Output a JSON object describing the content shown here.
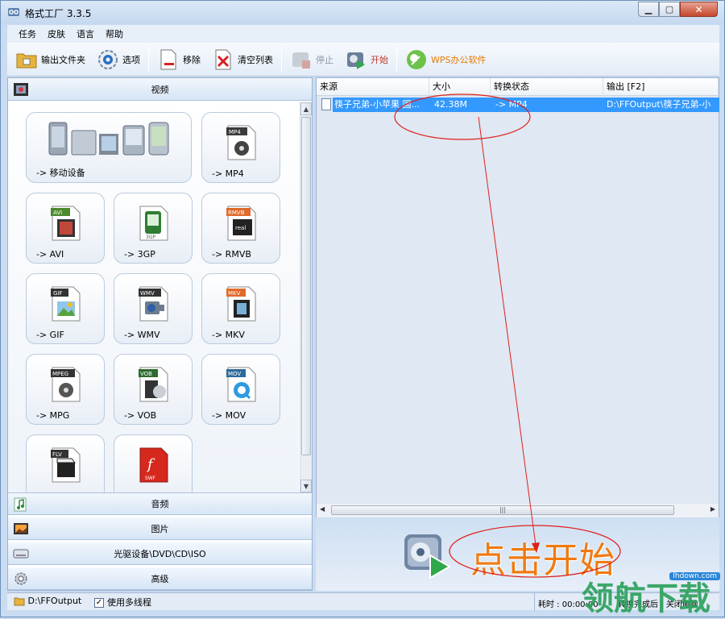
{
  "window": {
    "title": "格式工厂 3.3.5"
  },
  "menu": [
    "任务",
    "皮肤",
    "语言",
    "帮助"
  ],
  "toolbar": {
    "output_folder": "输出文件夹",
    "options": "选项",
    "remove": "移除",
    "clear_list": "清空列表",
    "stop": "停止",
    "start": "开始",
    "wps": "WPS办公软件"
  },
  "categories": {
    "video": "视频",
    "audio": "音频",
    "image": "图片",
    "disc": "光驱设备\\DVD\\CD\\ISO",
    "advanced": "高级"
  },
  "tiles": [
    {
      "label": "-> 移动设备",
      "badge": ""
    },
    {
      "label": "-> MP4",
      "badge": "MP4"
    },
    {
      "label": "-> AVI",
      "badge": "AVI"
    },
    {
      "label": "-> 3GP",
      "badge": "3GP"
    },
    {
      "label": "-> RMVB",
      "badge": "RMVB"
    },
    {
      "label": "-> GIF",
      "badge": "GIF"
    },
    {
      "label": "-> WMV",
      "badge": "WMV"
    },
    {
      "label": "-> MKV",
      "badge": "MKV"
    },
    {
      "label": "-> MPG",
      "badge": "MPEG"
    },
    {
      "label": "-> VOB",
      "badge": "VOB"
    },
    {
      "label": "-> MOV",
      "badge": "MOV"
    },
    {
      "label": "",
      "badge": "FLV"
    },
    {
      "label": "",
      "badge": "SWF"
    }
  ],
  "list": {
    "headers": [
      "来源",
      "大小",
      "转换状态",
      "输出 [F2]"
    ],
    "rows": [
      {
        "source": "筷子兄弟-小苹果 国...",
        "size": "42.38M",
        "status": "-> MP4",
        "output": "D:\\FFOutput\\筷子兄弟-小"
      }
    ]
  },
  "start_area": {
    "text": "点击开始"
  },
  "status": {
    "output_path": "D:\\FFOutput",
    "multithread_label": "使用多线程",
    "multithread_checked": "✓",
    "elapsed": "耗时 : 00:00:00",
    "after_convert": "转换完成后 : 关闭电脑"
  },
  "watermark": {
    "text": "领航下载",
    "url": "lhdown.com"
  },
  "colors": {
    "selection": "#3399ff",
    "accent": "#f07a10",
    "annotation": "#e0201a"
  }
}
